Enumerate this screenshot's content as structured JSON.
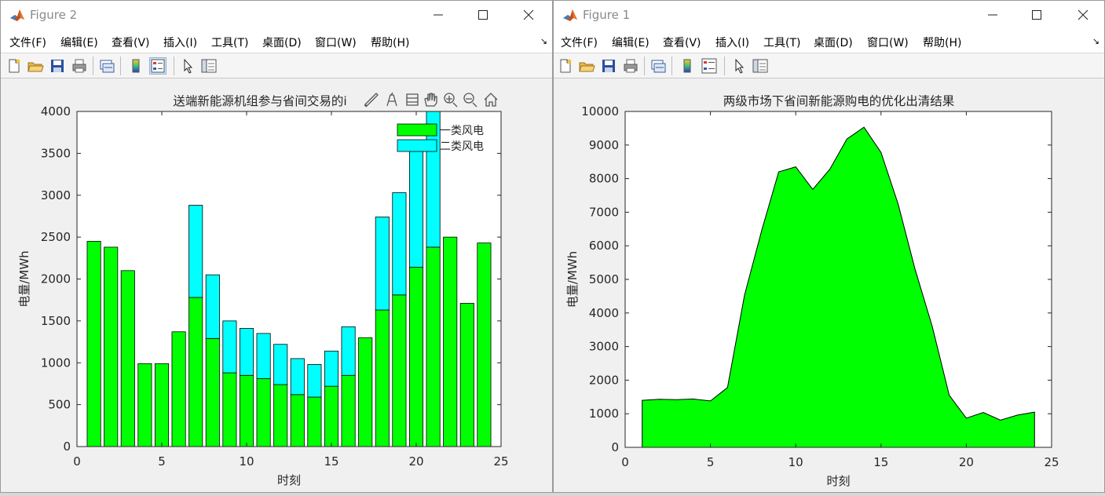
{
  "windows": [
    {
      "id": "fig2",
      "title": "Figure 2",
      "menus": [
        "文件(F)",
        "编辑(E)",
        "查看(V)",
        "插入(I)",
        "工具(T)",
        "桌面(D)",
        "窗口(W)",
        "帮助(H)"
      ],
      "menu_overflow": "↘"
    },
    {
      "id": "fig1",
      "title": "Figure 1",
      "menus": [
        "文件(F)",
        "编辑(E)",
        "查看(V)",
        "插入(I)",
        "工具(T)",
        "桌面(D)",
        "窗口(W)",
        "帮助(H)"
      ],
      "menu_overflow": "↘"
    }
  ],
  "toolbar_icons": [
    "new-figure-icon",
    "open-file-icon",
    "save-icon",
    "print-icon",
    "link-plot-icon",
    "colorbar-icon",
    "legend-icon",
    "pointer-icon",
    "property-inspector-icon"
  ],
  "axes_toolbar_icons": [
    "brush-icon",
    "data-tip-icon",
    "rotate-icon",
    "pan-icon",
    "zoom-in-icon",
    "zoom-out-icon",
    "home-icon"
  ],
  "colors": {
    "green": "#00ff00",
    "cyan": "#00ffff",
    "edge": "#000000"
  },
  "chart_data": [
    {
      "type": "bar",
      "stacked": true,
      "title": "送端新能源机组参与省间交易的i",
      "xlabel": "时刻",
      "ylabel": "电量/MWh",
      "xlim": [
        0,
        25
      ],
      "ylim": [
        0,
        4000
      ],
      "xticks": [
        0,
        5,
        10,
        15,
        20,
        25
      ],
      "yticks": [
        0,
        500,
        1000,
        1500,
        2000,
        2500,
        3000,
        3500,
        4000
      ],
      "x": [
        1,
        2,
        3,
        4,
        5,
        6,
        7,
        8,
        9,
        10,
        11,
        12,
        13,
        14,
        15,
        16,
        17,
        18,
        19,
        20,
        21,
        22,
        23,
        24
      ],
      "series": [
        {
          "name": "一类风电",
          "color": "#00ff00",
          "values": [
            2450,
            2380,
            2100,
            990,
            990,
            1370,
            1780,
            1290,
            880,
            850,
            810,
            740,
            620,
            590,
            720,
            850,
            1300,
            1630,
            1810,
            2140,
            2380,
            2500,
            1710,
            2430
          ]
        },
        {
          "name": "二类风电",
          "color": "#00ffff",
          "values": [
            0,
            0,
            0,
            0,
            0,
            0,
            1100,
            760,
            620,
            560,
            540,
            480,
            430,
            390,
            420,
            580,
            0,
            1110,
            1220,
            1500,
            1620,
            0,
            0,
            0
          ]
        }
      ],
      "legend": "top-right",
      "grid": false
    },
    {
      "type": "area",
      "title": "两级市场下省间新能源购电的优化出清结果",
      "xlabel": "时刻",
      "ylabel": "电量/MWh",
      "xlim": [
        0,
        25
      ],
      "ylim": [
        0,
        10000
      ],
      "xticks": [
        0,
        5,
        10,
        15,
        20,
        25
      ],
      "yticks": [
        0,
        1000,
        2000,
        3000,
        4000,
        5000,
        6000,
        7000,
        8000,
        9000,
        10000
      ],
      "x": [
        1,
        2,
        3,
        4,
        5,
        6,
        7,
        8,
        9,
        10,
        11,
        12,
        13,
        14,
        15,
        16,
        17,
        18,
        19,
        20,
        21,
        22,
        23,
        24
      ],
      "series": [
        {
          "color": "#00ff00",
          "values": [
            1400,
            1430,
            1420,
            1440,
            1380,
            1780,
            4530,
            6450,
            8200,
            8350,
            7680,
            8280,
            9180,
            9530,
            8780,
            7250,
            5300,
            3600,
            1550,
            870,
            1040,
            810,
            960,
            1050
          ]
        }
      ],
      "grid": false
    }
  ]
}
